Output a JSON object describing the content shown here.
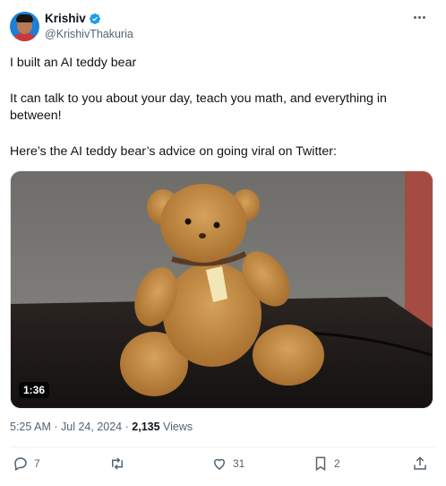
{
  "author": {
    "display_name": "Krishiv",
    "handle": "@KrishivThakuria",
    "verified_icon": "verified-badge-icon",
    "more_icon": "ellipsis-icon"
  },
  "tweet": {
    "line1": "I built an AI teddy bear",
    "line2": "It can talk to you about your day, teach you math, and everything in between!",
    "line3": "Here’s the AI teddy bear’s advice on going viral on Twitter:"
  },
  "media": {
    "duration": "1:36"
  },
  "meta": {
    "time": "5:25 AM",
    "date": "Jul 24, 2024",
    "views_count": "2,135",
    "views_label": "Views",
    "separator": "·"
  },
  "actions": {
    "replies": "7",
    "retweets": "",
    "likes": "31",
    "bookmarks": "2"
  },
  "colors": {
    "accent": "#1d9bf0",
    "muted": "#536471"
  }
}
